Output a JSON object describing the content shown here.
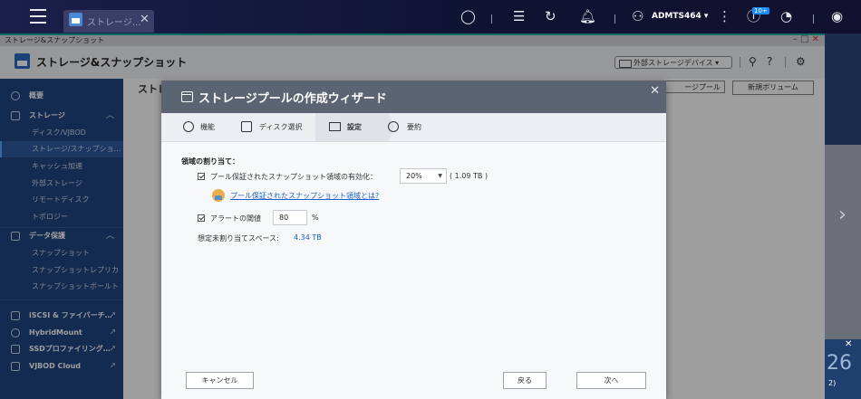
{
  "taskbar": {
    "app_tab_title": "ストレージ…",
    "user": "ADMTS464 ▾",
    "notification_badge": "10+"
  },
  "window": {
    "title": "ストレージ&スナップショット",
    "header_title": "ストレージ&スナップショット",
    "external_device_label": "外部ストレージデバイス ▾"
  },
  "sidebar": {
    "items": [
      {
        "label": "概要",
        "type": "top"
      },
      {
        "label": "ストレージ",
        "type": "top"
      },
      {
        "label": "ディスク/VJBOD",
        "type": "sub"
      },
      {
        "label": "ストレージ/スナップショ…",
        "type": "sub",
        "active": true
      },
      {
        "label": "キャッシュ加速",
        "type": "sub"
      },
      {
        "label": "外部ストレージ",
        "type": "sub"
      },
      {
        "label": "リモートディスク",
        "type": "sub"
      },
      {
        "label": "トポロジー",
        "type": "sub"
      },
      {
        "label": "データ保護",
        "type": "top"
      },
      {
        "label": "スナップショット",
        "type": "sub"
      },
      {
        "label": "スナップショットレプリカ",
        "type": "sub"
      },
      {
        "label": "スナップショットボールト",
        "type": "sub"
      },
      {
        "label": "iSCSI & ファイバーチ…",
        "type": "top"
      },
      {
        "label": "HybridMount",
        "type": "top"
      },
      {
        "label": "SSDプロファイリング…",
        "type": "top"
      },
      {
        "label": "VJBOD Cloud",
        "type": "top"
      }
    ]
  },
  "main": {
    "title": "ストレ",
    "btn_pool": "ージプール",
    "btn_volume": "新規ボリューム"
  },
  "notification": {
    "big": "26",
    "small": "2)"
  },
  "dialog": {
    "title": "ストレージプールの作成ウィザード",
    "steps": [
      "機能",
      "ディスク選択",
      "設定",
      "要約"
    ],
    "section_title": "領域の割り当て：",
    "snapshot_label": "プール保証されたスナップショット領域の有効化：",
    "snapshot_value": "20%",
    "snapshot_size": "( 1.09 TB )",
    "help_link": "プール保証されたスナップショット領域とは?",
    "alert_label": "アラートの閾値",
    "alert_value": "80",
    "alert_unit": "%",
    "estimate_label": "想定未割り当てスペース:",
    "estimate_value": "4.34 TB",
    "btn_cancel": "キャンセル",
    "btn_back": "戻る",
    "btn_next": "次へ"
  }
}
